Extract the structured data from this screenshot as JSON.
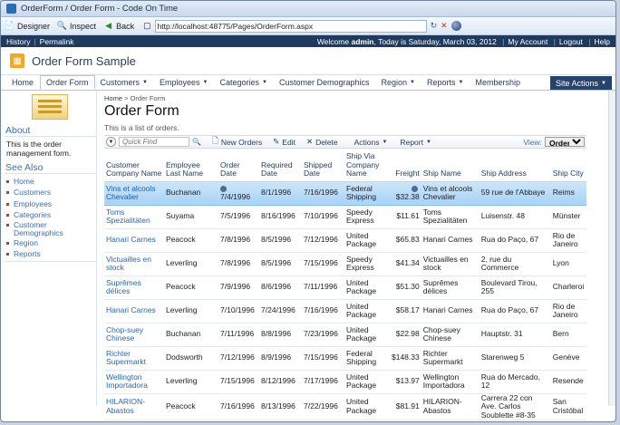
{
  "window": {
    "title": "OrderForm / Order Form - Code On Time"
  },
  "browser": {
    "designer": "Designer",
    "inspect": "Inspect",
    "back": "Back",
    "url": "http://localhost:48775/Pages/OrderForm.aspx"
  },
  "topbar": {
    "history": "History",
    "permalink": "Permalink",
    "welcome_prefix": "Welcome",
    "user": "admin",
    "welcome_suffix": ", Today is Saturday, March 03, 2012",
    "my_account": "My Account",
    "logout": "Logout",
    "help": "Help"
  },
  "app": {
    "title": "Order Form Sample"
  },
  "menu": {
    "items": [
      "Home",
      "Order Form",
      "Customers",
      "Employees",
      "Categories",
      "Customer Demographics",
      "Region",
      "Reports",
      "Membership"
    ],
    "site_actions": "Site Actions"
  },
  "sidebar": {
    "about_title": "About",
    "about_text": "This is the order management form.",
    "see_also_title": "See Also",
    "links": [
      "Home",
      "Customers",
      "Employees",
      "Categories",
      "Customer Demographics",
      "Region",
      "Reports"
    ]
  },
  "page": {
    "breadcrumb_home": "Home",
    "breadcrumb_current": "Order Form",
    "title": "Order Form",
    "description": "This is a list of orders."
  },
  "actions": {
    "quick_find_placeholder": "Quick Find",
    "new_orders": "New Orders",
    "edit": "Edit",
    "delete": "Delete",
    "actions": "Actions",
    "report": "Report",
    "view_label": "View:",
    "view_value": "Orders"
  },
  "table": {
    "headers": [
      "Customer Company Name",
      "Employee Last Name",
      "Order Date",
      "Required Date",
      "Shipped Date",
      "Ship Via Company Name",
      "Freight",
      "Ship Name",
      "Ship Address",
      "Ship City"
    ],
    "rows": [
      [
        "Vins et alcools Chevalier",
        "Buchanan",
        "7/4/1996",
        "8/1/1996",
        "7/16/1996",
        "Federal Shipping",
        "$32.38",
        "Vins et alcools Chevalier",
        "59 rue de l'Abbaye",
        "Reims"
      ],
      [
        "Toms Spezialitäten",
        "Suyama",
        "7/5/1996",
        "8/16/1996",
        "7/10/1996",
        "Speedy Express",
        "$11.61",
        "Toms Spezialitäten",
        "Luisenstr. 48",
        "Münster"
      ],
      [
        "Hanari Carnes",
        "Peacock",
        "7/8/1996",
        "8/5/1996",
        "7/12/1996",
        "United Package",
        "$65.83",
        "Hanari Carnes",
        "Rua do Paço, 67",
        "Rio de Janeiro"
      ],
      [
        "Victuailles en stock",
        "Leverling",
        "7/8/1996",
        "8/5/1996",
        "7/15/1996",
        "Speedy Express",
        "$41.34",
        "Victuailles en stock",
        "2, rue du Commerce",
        "Lyon"
      ],
      [
        "Suprêmes délices",
        "Peacock",
        "7/9/1996",
        "8/6/1996",
        "7/11/1996",
        "United Package",
        "$51.30",
        "Suprêmes délices",
        "Boulevard Tirou, 255",
        "Charleroi"
      ],
      [
        "Hanari Carnes",
        "Leverling",
        "7/10/1996",
        "7/24/1996",
        "7/16/1996",
        "United Package",
        "$58.17",
        "Hanari Carnes",
        "Rua do Paço, 67",
        "Rio de Janeiro"
      ],
      [
        "Chop-suey Chinese",
        "Buchanan",
        "7/11/1996",
        "8/8/1996",
        "7/23/1996",
        "United Package",
        "$22.98",
        "Chop-suey Chinese",
        "Hauptstr. 31",
        "Bern"
      ],
      [
        "Richter Supermarkt",
        "Dodsworth",
        "7/12/1996",
        "8/9/1996",
        "7/15/1996",
        "Federal Shipping",
        "$148.33",
        "Richter Supermarkt",
        "Starenweg 5",
        "Genève"
      ],
      [
        "Wellington Importadora",
        "Leverling",
        "7/15/1996",
        "8/12/1996",
        "7/17/1996",
        "United Package",
        "$13.97",
        "Wellington Importadora",
        "Rua do Mercado, 12",
        "Resende"
      ],
      [
        "HILARION-Abastos",
        "Peacock",
        "7/16/1996",
        "8/13/1996",
        "7/22/1996",
        "United Package",
        "$81.91",
        "HILARION-Abastos",
        "Carrera 22 con Ave. Carlos Soublette #8-35",
        "San Cristóbal"
      ]
    ]
  }
}
